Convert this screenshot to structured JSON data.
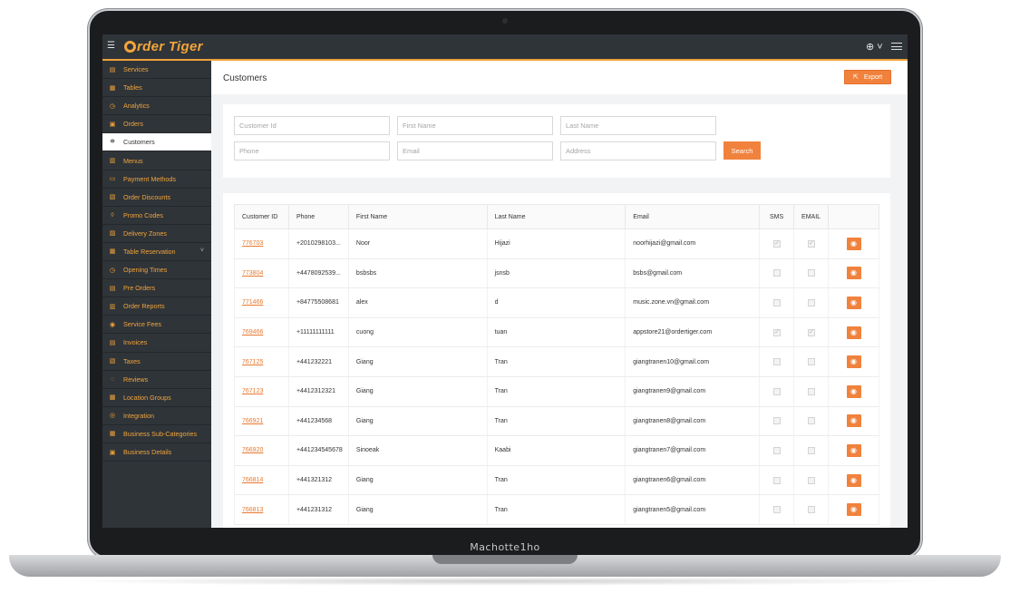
{
  "device": {
    "brand_label": "Machotte1ho"
  },
  "app": {
    "logo_text": "rder Tiger",
    "lang_icon": "globe-icon"
  },
  "sidebar": {
    "items": [
      {
        "label": "Services",
        "icon": "list-icon"
      },
      {
        "label": "Tables",
        "icon": "grid-icon"
      },
      {
        "label": "Analytics",
        "icon": "clock-icon"
      },
      {
        "label": "Orders",
        "icon": "box-icon"
      },
      {
        "label": "Customers",
        "icon": "users-icon",
        "active": true
      },
      {
        "label": "Menus",
        "icon": "menu-icon"
      },
      {
        "label": "Payment Methods",
        "icon": "card-icon"
      },
      {
        "label": "Order Discounts",
        "icon": "tag-icon"
      },
      {
        "label": "Promo Codes",
        "icon": "ticket-icon"
      },
      {
        "label": "Delivery Zones",
        "icon": "map-icon"
      },
      {
        "label": "Table Reservation",
        "icon": "calendar-icon",
        "expandable": true
      },
      {
        "label": "Opening Times",
        "icon": "clock-icon"
      },
      {
        "label": "Pre Orders",
        "icon": "doc-icon"
      },
      {
        "label": "Order Reports",
        "icon": "report-icon"
      },
      {
        "label": "Service Fees",
        "icon": "coin-icon"
      },
      {
        "label": "Invoices",
        "icon": "invoice-icon"
      },
      {
        "label": "Taxes",
        "icon": "percent-icon"
      },
      {
        "label": "Reviews",
        "icon": "star-icon"
      },
      {
        "label": "Location Groups",
        "icon": "location-icon"
      },
      {
        "label": "Integration",
        "icon": "plug-icon"
      },
      {
        "label": "Business Sub-Categories",
        "icon": "folder-icon"
      },
      {
        "label": "Business Details",
        "icon": "building-icon"
      }
    ]
  },
  "page": {
    "title": "Customers",
    "export_label": "Export"
  },
  "filters": {
    "customer_id": "Customer Id",
    "first_name": "First Name",
    "last_name": "Last Name",
    "phone": "Phone",
    "email": "Email",
    "address": "Address",
    "search_label": "Search"
  },
  "table": {
    "headers": [
      "Customer ID",
      "Phone",
      "First Name",
      "Last Name",
      "Email",
      "SMS",
      "EMAIL",
      ""
    ],
    "rows": [
      {
        "id": "776703",
        "phone": "+2010298103...",
        "first": "Noor",
        "last": "Hijazi",
        "email": "noorhijazi@gmail.com",
        "sms": true,
        "em": true
      },
      {
        "id": "773804",
        "phone": "+4478092539...",
        "first": "bsbsbs",
        "last": "jsnsb",
        "email": "bsbs@gmail.com",
        "sms": false,
        "em": false
      },
      {
        "id": "771466",
        "phone": "+84775508681",
        "first": "alex",
        "last": "d",
        "email": "music.zone.vn@gmail.com",
        "sms": false,
        "em": false
      },
      {
        "id": "769466",
        "phone": "+11111111111",
        "first": "cuong",
        "last": "tuan",
        "email": "appstore21@ordertiger.com",
        "sms": true,
        "em": true
      },
      {
        "id": "767125",
        "phone": "+441232221",
        "first": "Giang",
        "last": "Tran",
        "email": "giangtranen10@gmail.com",
        "sms": false,
        "em": false
      },
      {
        "id": "767123",
        "phone": "+4412312321",
        "first": "Giang",
        "last": "Tran",
        "email": "giangtranen9@gmail.com",
        "sms": false,
        "em": false
      },
      {
        "id": "766921",
        "phone": "+441234568",
        "first": "Giang",
        "last": "Tran",
        "email": "giangtranen8@gmail.com",
        "sms": false,
        "em": false
      },
      {
        "id": "766920",
        "phone": "+441234545678",
        "first": "Sinoeak",
        "last": "Kaabi",
        "email": "giangtranen7@gmail.com",
        "sms": false,
        "em": false
      },
      {
        "id": "766814",
        "phone": "+441321312",
        "first": "Giang",
        "last": "Tran",
        "email": "giangtranen6@gmail.com",
        "sms": false,
        "em": false
      },
      {
        "id": "766813",
        "phone": "+441231312",
        "first": "Giang",
        "last": "Tran",
        "email": "giangtranen5@gmail.com",
        "sms": false,
        "em": false
      }
    ]
  }
}
